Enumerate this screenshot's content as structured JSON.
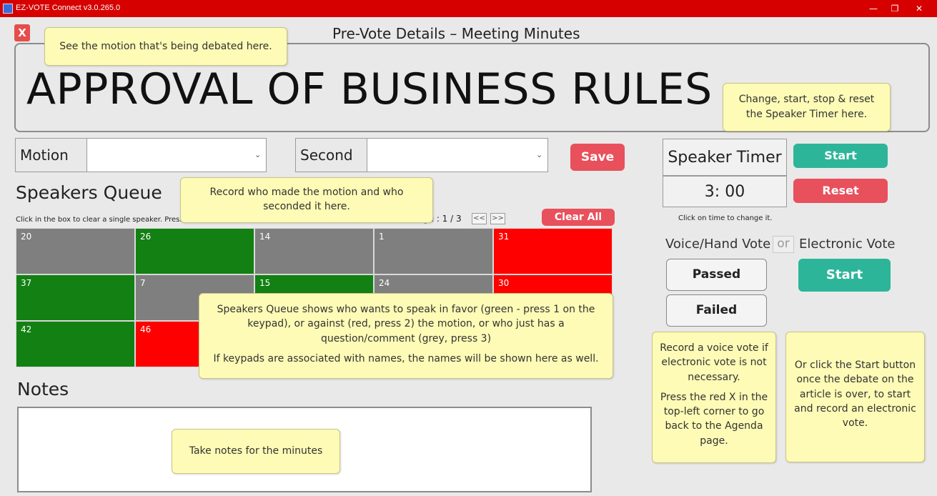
{
  "window": {
    "title": "EZ-VOTE Connect v3.0.265.0",
    "minimize": "—",
    "restore": "❐",
    "close": "✕"
  },
  "close_button": "X",
  "page_title": "Pre-Vote Details – Meeting Minutes",
  "motion_title": "APPROVAL OF BUSINESS RULES",
  "fields": {
    "motion_label": "Motion",
    "motion_value": "",
    "second_label": "Second",
    "second_value": "",
    "save": "Save"
  },
  "speakers_queue": {
    "title": "Speakers Queue",
    "hint_left": "Click in the box to clear a single speaker. Press",
    "page_label": "ge : 1 / 3",
    "prev": "<<",
    "next": ">>",
    "clear_all": "Clear All",
    "cells": [
      {
        "num": "20",
        "color": "#7f7f7f"
      },
      {
        "num": "26",
        "color": "#128012"
      },
      {
        "num": "14",
        "color": "#7f7f7f"
      },
      {
        "num": "1",
        "color": "#7f7f7f"
      },
      {
        "num": "31",
        "color": "#ff0000"
      },
      {
        "num": "37",
        "color": "#128012"
      },
      {
        "num": "7",
        "color": "#7f7f7f"
      },
      {
        "num": "15",
        "color": "#128012"
      },
      {
        "num": "24",
        "color": "#7f7f7f"
      },
      {
        "num": "30",
        "color": "#ff0000"
      },
      {
        "num": "42",
        "color": "#128012"
      },
      {
        "num": "46",
        "color": "#ff0000"
      }
    ]
  },
  "notes": {
    "title": "Notes",
    "value": ""
  },
  "timer": {
    "label": "Speaker Timer",
    "time": "3: 00",
    "start": "Start",
    "reset": "Reset",
    "hint": "Click on time to change it."
  },
  "vote": {
    "voice_label": "Voice/Hand Vote",
    "or": "or",
    "electronic_label": "Electronic Vote",
    "passed": "Passed",
    "failed": "Failed",
    "start": "Start"
  },
  "tooltips": {
    "motion": "See the motion that's being debated here.",
    "timer": "Change, start, stop & reset the Speaker Timer here.",
    "record": "Record who made the motion and who seconded it here.",
    "queue_1": "Speakers Queue shows who wants to speak in favor (green - press 1 on the keypad), or against (red, press 2) the motion, or who just has a question/comment (grey, press 3)",
    "queue_2": "If keypads are associated with names, the names will be shown here as well.",
    "notes": "Take notes for the minutes",
    "voice_1": "Record a voice vote if electronic vote is not necessary.",
    "voice_2": "Press the red X in the top-left corner to go back to the Agenda page.",
    "electronic": "Or click the Start button once the debate on the article is over, to start and record an electronic vote."
  }
}
